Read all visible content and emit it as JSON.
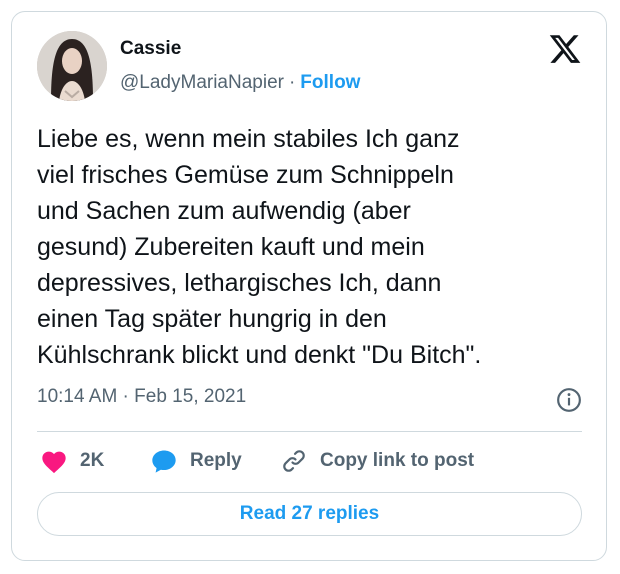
{
  "author": {
    "name": "Cassie",
    "handle": "@LadyMariaNapier",
    "separator": "·",
    "follow_label": "Follow"
  },
  "tweet": {
    "text": "Liebe es, wenn mein stabiles Ich ganz\nviel frisches Gemüse zum Schnippeln\nund Sachen zum aufwendig (aber\ngesund) Zubereiten kauft und mein\ndepressives, lethargisches Ich, dann\neinen Tag später hungrig in den\nKühlschrank blickt und denkt \"Du Bitch\".",
    "timestamp": "10:14 AM · Feb 15, 2021"
  },
  "actions": {
    "like_count": "2K",
    "reply_label": "Reply",
    "copy_link_label": "Copy link to post"
  },
  "footer": {
    "read_replies_label": "Read 27 replies"
  },
  "colors": {
    "accent": "#1d9bf0",
    "like": "#f91880",
    "muted": "#536471",
    "text": "#0f1419"
  },
  "icons": {
    "brand": "x-logo-icon",
    "info": "info-icon",
    "like": "heart-icon",
    "reply": "speech-bubble-icon",
    "copy": "link-icon"
  }
}
